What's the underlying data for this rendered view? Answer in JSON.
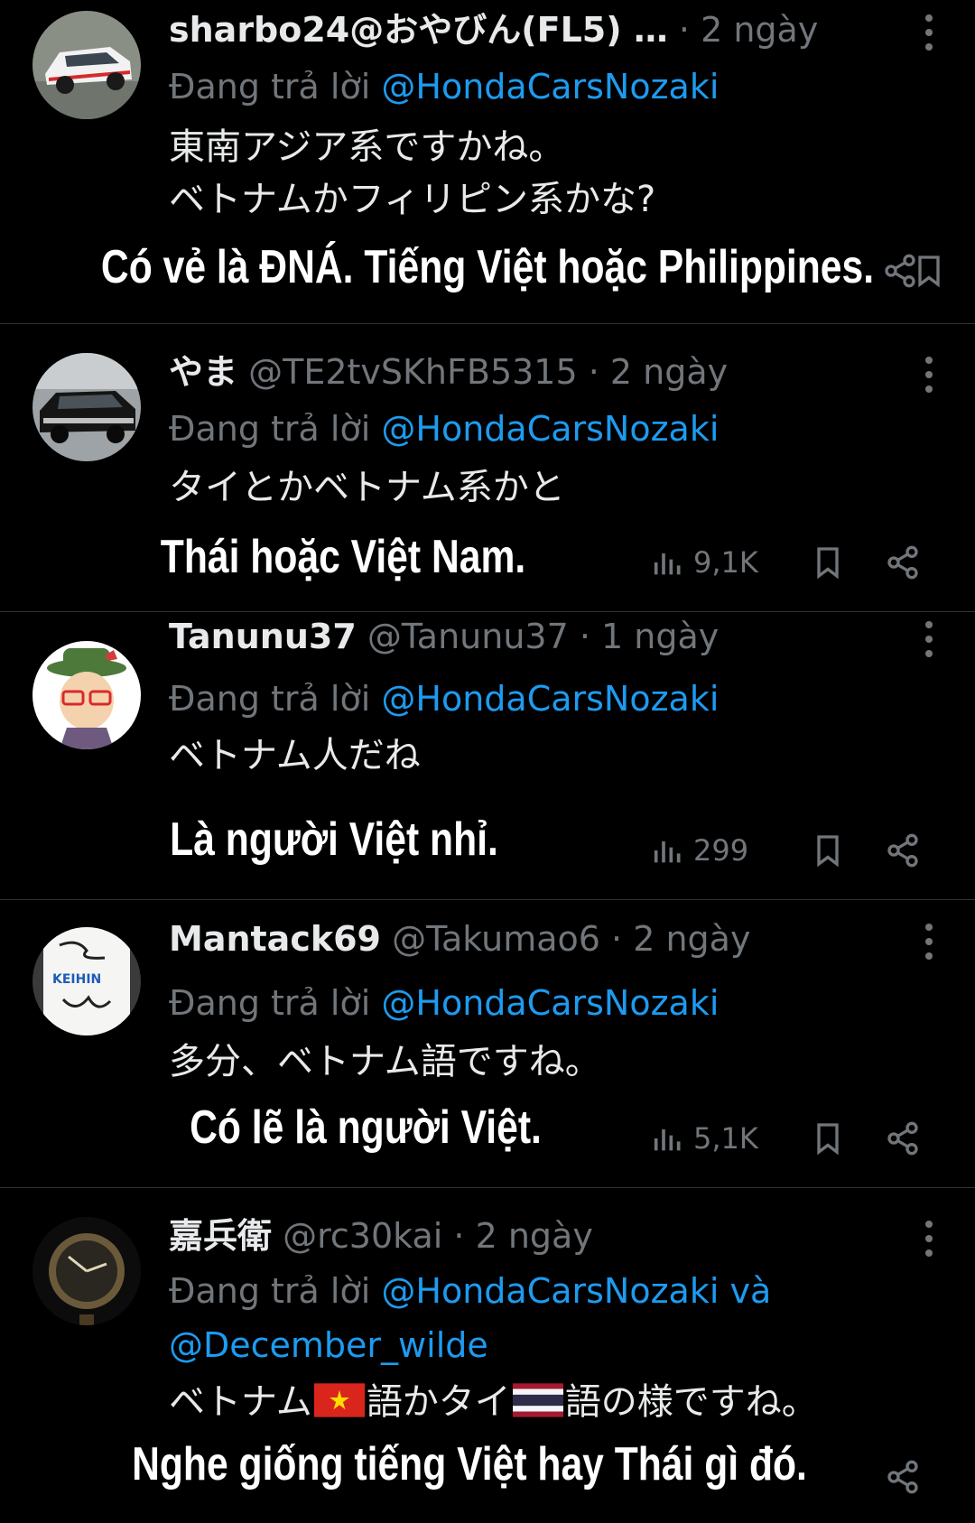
{
  "reply_prefix": "Đang trả lời",
  "posts": [
    {
      "name": "sharbo24@おやびん(FL5) …",
      "handle": "",
      "time": "· 2 ngày",
      "reply_to": "@HondaCarsNozaki",
      "reply_extra_join": "",
      "reply_extra": "",
      "text_line1": "東南アジア系ですかね。",
      "text_line2": "ベトナムかフィリピン系かな?",
      "views": "",
      "caption": "Có vẻ là ĐNÁ. Tiếng Việt hoặc Philippines."
    },
    {
      "name": "やま",
      "handle": "@TE2tvSKhFB5315",
      "time": "· 2 ngày",
      "reply_to": "@HondaCarsNozaki",
      "reply_extra_join": "",
      "reply_extra": "",
      "text_line1": "タイとかベトナム系かと",
      "text_line2": "",
      "views": "9,1K",
      "caption": "Thái hoặc Việt Nam."
    },
    {
      "name": "Tanunu37",
      "handle": "@Tanunu37",
      "time": "· 1 ngày",
      "reply_to": "@HondaCarsNozaki",
      "reply_extra_join": "",
      "reply_extra": "",
      "text_line1": "ベトナム人だね",
      "text_line2": "",
      "views": "299",
      "caption": "Là người Việt nhỉ."
    },
    {
      "name": "Mantack69",
      "handle": "@Takumao6",
      "time": "· 2 ngày",
      "reply_to": "@HondaCarsNozaki",
      "reply_extra_join": "",
      "reply_extra": "",
      "text_line1": "多分、ベトナム語ですね。",
      "text_line2": "",
      "views": "5,1K",
      "caption": "Có lẽ là người Việt."
    },
    {
      "name": "嘉兵衛",
      "handle": "@rc30kai",
      "time": "· 2 ngày",
      "reply_to": "@HondaCarsNozaki",
      "reply_extra_join": "và",
      "reply_extra": "@December_wilde",
      "text_a": "ベトナム",
      "text_b": "語かタイ",
      "text_c": "語の様ですね。",
      "views": "",
      "caption": "Nghe giống tiếng Việt hay Thái gì đó."
    }
  ],
  "colors": {
    "background": "#000000",
    "primary_text": "#e7e9ea",
    "secondary_text": "#71767b",
    "mention": "#1d9bf0",
    "divider": "#2f3336"
  },
  "icons": [
    "more-icon",
    "views-icon",
    "bookmark-icon",
    "share-icon",
    "vietnam-flag-icon",
    "thailand-flag-icon"
  ]
}
